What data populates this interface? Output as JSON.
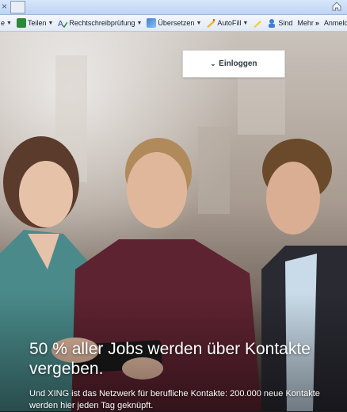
{
  "browser": {
    "tab_close": "×",
    "toolbar": {
      "items": [
        {
          "label": "e",
          "icon": "dropdown-arrow"
        },
        {
          "label": "Teilen",
          "icon": "share-icon"
        },
        {
          "label": "Rechtschreibprüfung",
          "icon": "spellcheck-icon"
        },
        {
          "label": "Übersetzen",
          "icon": "translate-icon"
        },
        {
          "label": "AutoFill",
          "icon": "autofill-icon"
        },
        {
          "label": "Sind",
          "icon": "user-icon"
        },
        {
          "label": "Mehr",
          "icon": "more-icon"
        }
      ],
      "more_symbol": "»",
      "right_label": "Anmeld"
    }
  },
  "page": {
    "login_dropdown": {
      "label": "Einloggen",
      "chevron": "⌄"
    },
    "headline": "50 % aller Jobs werden über Kontakte vergeben.",
    "subline": "Und XING ist das Netzwerk für berufliche Kontakte: 200.000 neue Kontakte werden hier jeden Tag geknüpft."
  },
  "colors": {
    "accent_green": "#1f8a3a",
    "dropdown_text": "#2b3640",
    "hero_text": "#ffffff"
  }
}
